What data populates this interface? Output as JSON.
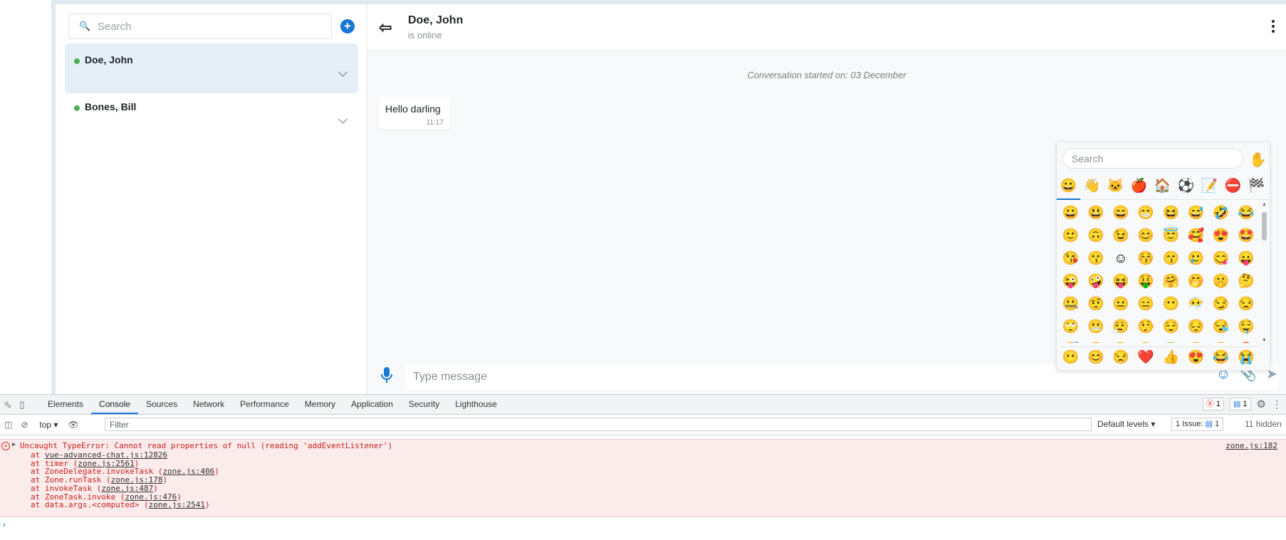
{
  "rooms_panel": {
    "search_placeholder": "Search",
    "rooms": [
      {
        "name": "Doe, John",
        "online": true,
        "active": true
      },
      {
        "name": "Bones, Bill",
        "online": true,
        "active": false
      }
    ]
  },
  "chat": {
    "header_name": "Doe, John",
    "header_status": "is online",
    "conversation_started": "Conversation started on: 03 December",
    "messages": [
      {
        "text": "Hello darling",
        "time": "11:17"
      }
    ],
    "input_placeholder": "Type message"
  },
  "emoji_picker": {
    "search_placeholder": "Search",
    "skin_tone": "✋",
    "categories": [
      "😀",
      "👋",
      "🐱",
      "🍎",
      "🏠",
      "⚽",
      "📝",
      "⛔",
      "🏁"
    ],
    "grid": [
      "😀",
      "😃",
      "😄",
      "😁",
      "😆",
      "😅",
      "🤣",
      "😂",
      "🙂",
      "🙃",
      "😉",
      "😊",
      "😇",
      "🥰",
      "😍",
      "🤩",
      "😘",
      "😗",
      "☺",
      "😚",
      "😙",
      "🥲",
      "😋",
      "😛",
      "😜",
      "🤪",
      "😝",
      "🤑",
      "🤗",
      "🤭",
      "🤫",
      "🤔",
      "🤐",
      "🤨",
      "😐",
      "😑",
      "😶",
      "😶‍🌫️",
      "😏",
      "😒",
      "🙄",
      "😬",
      "😮‍💨",
      "🤥",
      "😌",
      "😔",
      "😪",
      "🤤",
      "😴",
      "😷",
      "🤒",
      "🤕",
      "🤢",
      "🤮",
      "🤧",
      "🥵"
    ],
    "recent": [
      "😶",
      "😊",
      "😒",
      "❤️",
      "👍",
      "😍",
      "😂",
      "😭"
    ]
  },
  "devtools": {
    "tabs": [
      "Elements",
      "Console",
      "Sources",
      "Network",
      "Performance",
      "Memory",
      "Application",
      "Security",
      "Lighthouse"
    ],
    "active_tab": "Console",
    "error_count": "1",
    "info_count": "1",
    "context": "top",
    "filter_placeholder": "Filter",
    "levels": "Default levels",
    "issues": "1 Issue:",
    "issues_count": "1",
    "hidden": "11 hidden",
    "error": {
      "message": "Uncaught TypeError: Cannot read properties of null (reading 'addEventListener')",
      "source": "zone.js:182",
      "stack": [
        {
          "prefix": "at ",
          "fn": "",
          "loc": "vue-advanced-chat.js:12826"
        },
        {
          "prefix": "at timer (",
          "fn": "",
          "loc": "zone.js:2561",
          "suffix": ")"
        },
        {
          "prefix": "at ZoneDelegate.invokeTask (",
          "loc": "zone.js:406",
          "suffix": ")"
        },
        {
          "prefix": "at Zone.runTask (",
          "loc": "zone.js:178",
          "suffix": ")"
        },
        {
          "prefix": "at invokeTask (",
          "loc": "zone.js:487",
          "suffix": ")"
        },
        {
          "prefix": "at ZoneTask.invoke (",
          "loc": "zone.js:476",
          "suffix": ")"
        },
        {
          "prefix": "at data.args.<computed> (",
          "loc": "zone.js:2541",
          "suffix": ")"
        }
      ]
    }
  }
}
